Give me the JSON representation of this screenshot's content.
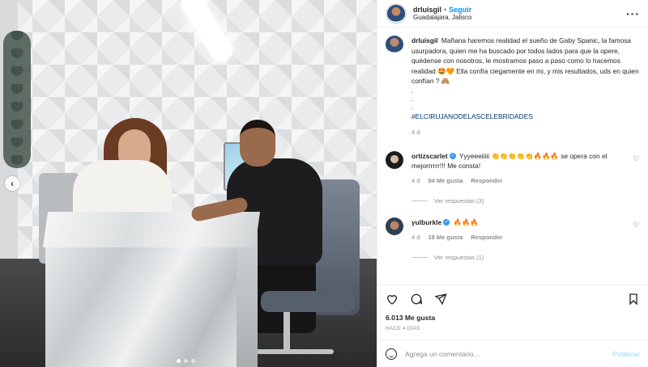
{
  "post": {
    "username": "drluisgil",
    "follow_label": "Seguir",
    "location": "Guadalajara, Jalisco",
    "more_icon": "more-horizontal-icon"
  },
  "caption": {
    "username": "drluisgil",
    "text_1": "Mañana haremos realidad el sueño de Gaby Spanic, la famosa usurpadora, quien me ha buscado por todos lados para que la opere, quédense con nosotros, le mostramos paso a paso como lo hacemos realidad 🤩🧡 Ella confía ciegamente en mi, y mis resultados, uds en quien confían ? 🙈",
    "dot_1": ".",
    "dot_2": ".",
    "dot_3": ".",
    "hashtag": "#ELCIRUJANODELASCELEBRIDADES",
    "time": "4 d"
  },
  "comments": [
    {
      "username": "ortizscarlet",
      "text": "Yyyeeeiiiii 👏👏👏👏👏🔥🔥🔥 se opera con el mejorrrrrr!!! Me consta!",
      "time": "4 d",
      "likes": "94 Me gusta",
      "reply_label": "Responder",
      "view_replies": "Ver respuestas (3)"
    },
    {
      "username": "yulburkle",
      "text": "🔥🔥🔥",
      "time": "4 d",
      "likes": "18 Me gusta",
      "reply_label": "Responder",
      "view_replies": "Ver respuestas (1)"
    }
  ],
  "actions": {
    "like_icon": "heart-icon",
    "comment_icon": "comment-icon",
    "share_icon": "send-icon",
    "save_icon": "bookmark-icon",
    "likes_text": "6.013 Me gusta",
    "posted_ago": "HACE 4 DÍAS"
  },
  "composer": {
    "placeholder": "Agrega un comentario...",
    "publish_label": "Publicar"
  },
  "carousel": {
    "prev_glyph": "‹",
    "slide_count": 3,
    "active_slide": 1
  },
  "colors": {
    "accent": "#0095f6",
    "hashtag": "#00376b",
    "muted": "#8e8e8e"
  }
}
